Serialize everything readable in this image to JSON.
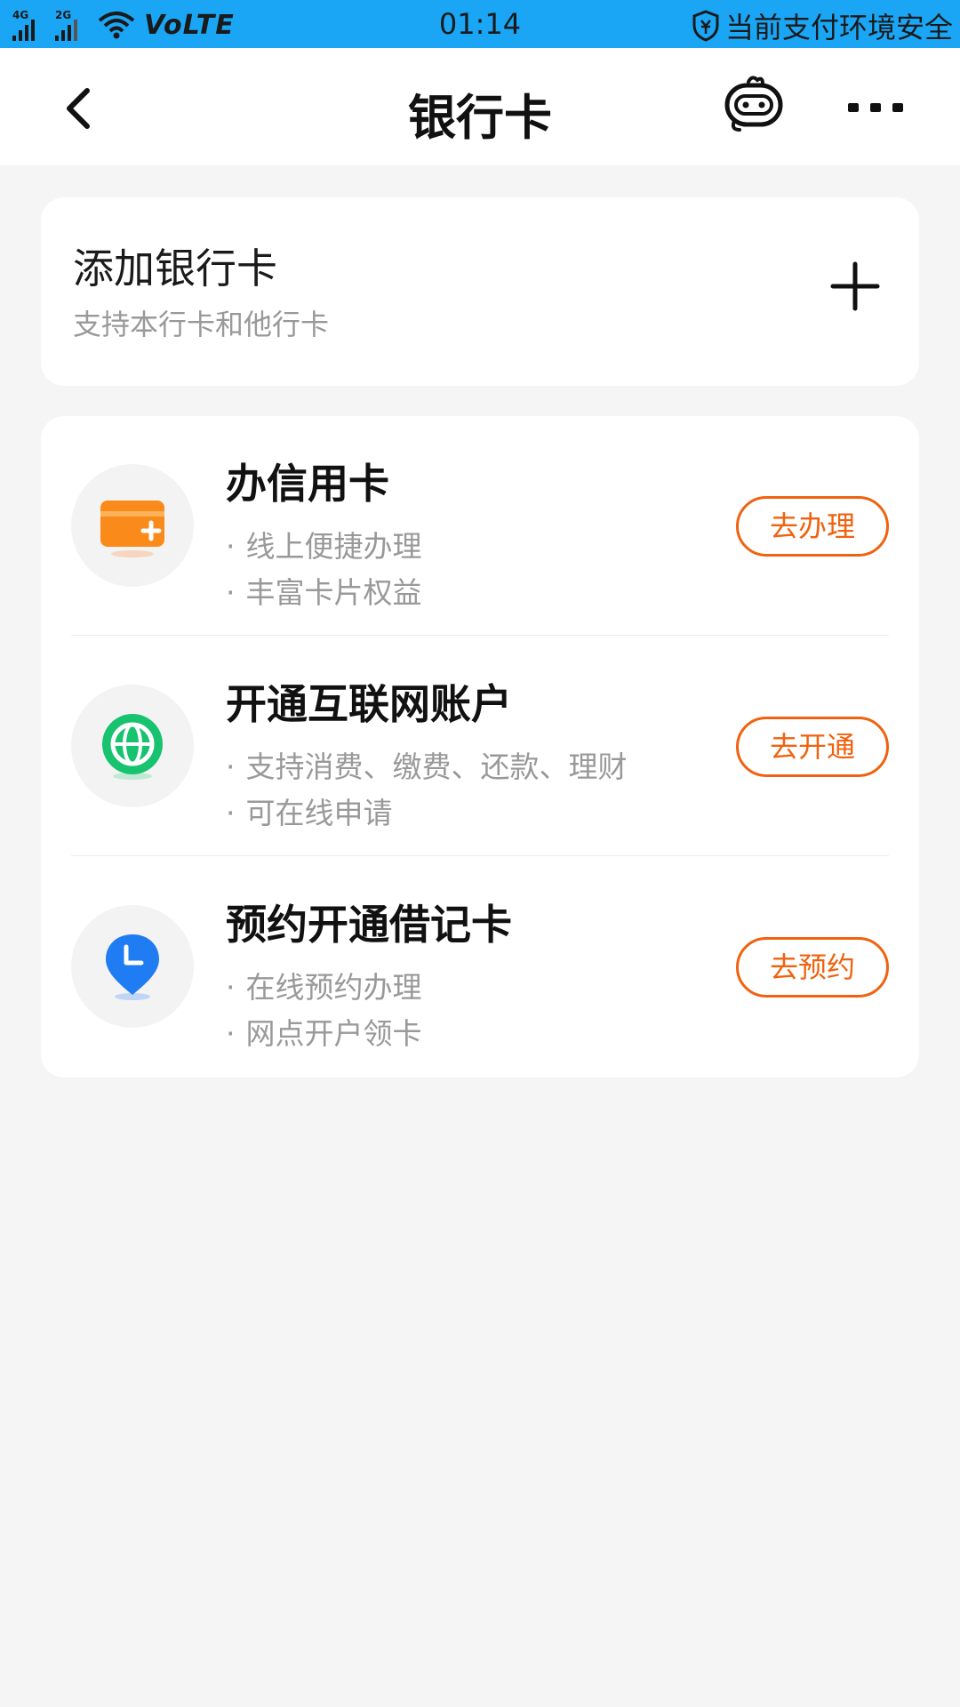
{
  "status_bar": {
    "signal1_tag": "4G",
    "signal2_tag": "2G",
    "network": "VoLTE",
    "time": "01:14",
    "security_text": "当前支付环境安全"
  },
  "nav": {
    "title": "银行卡",
    "icons": [
      "back-arrow-icon",
      "robot-assistant-icon",
      "more-icon"
    ]
  },
  "add_card": {
    "title": "添加银行卡",
    "subtitle": "支持本行卡和他行卡",
    "icon": "plus-icon"
  },
  "services": [
    {
      "title": "办信用卡",
      "lines": [
        "线上便捷办理",
        "丰富卡片权益"
      ],
      "button": "去办理",
      "icon": "credit-card-icon"
    },
    {
      "title": "开通互联网账户",
      "lines": [
        "支持消费、缴费、还款、理财",
        "可在线申请"
      ],
      "button": "去开通",
      "icon": "globe-icon"
    },
    {
      "title": "预约开通借记卡",
      "lines": [
        "在线预约办理",
        "网点开户领卡"
      ],
      "button": "去预约",
      "icon": "location-clock-icon"
    }
  ],
  "colors": {
    "status_bar_bg": "#1aa6f5",
    "accent": "#f0620f",
    "page_bg": "#f5f5f5"
  }
}
